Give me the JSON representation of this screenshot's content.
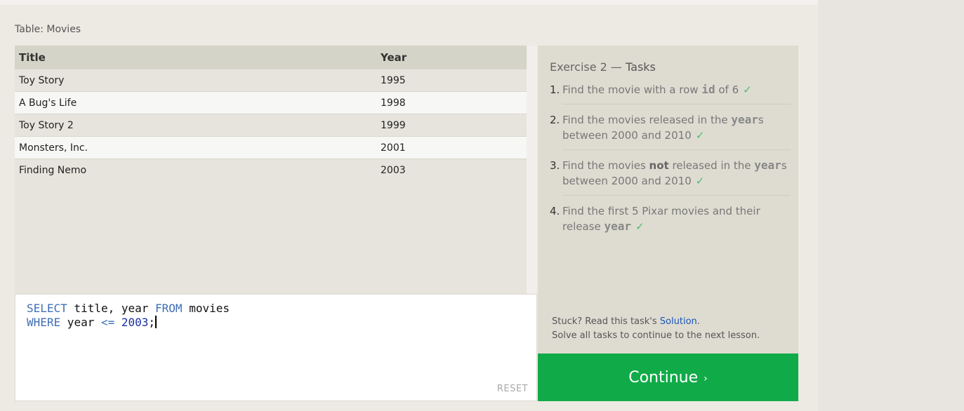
{
  "table": {
    "caption": "Table: Movies",
    "columns": [
      "Title",
      "Year"
    ],
    "rows": [
      [
        "Toy Story",
        "1995"
      ],
      [
        "A Bug's Life",
        "1998"
      ],
      [
        "Toy Story 2",
        "1999"
      ],
      [
        "Monsters, Inc.",
        "2001"
      ],
      [
        "Finding Nemo",
        "2003"
      ]
    ]
  },
  "editor": {
    "line1": {
      "kw1": "SELECT",
      "t1": " title, year ",
      "kw2": "FROM",
      "t2": " movies"
    },
    "line2": {
      "kw1": "WHERE",
      "t1": " year ",
      "op": "<=",
      "t2": " ",
      "num": "2003",
      "t3": ";"
    },
    "reset_label": "RESET"
  },
  "exercise": {
    "title": "Exercise 2",
    "dash": " — ",
    "subtitle": "Tasks",
    "tasks": [
      {
        "num": "1.",
        "parts": [
          "Find the movie with a row ",
          "id",
          " of 6"
        ]
      },
      {
        "num": "2.",
        "parts": [
          "Find the movies released in the ",
          "year",
          "s between 2000 and 2010"
        ]
      },
      {
        "num": "3.",
        "parts": [
          "Find the movies ",
          "not",
          " released in the ",
          "year",
          "s between 2000 and 2010"
        ]
      },
      {
        "num": "4.",
        "parts": [
          "Find the first 5 Pixar movies and their release ",
          "year"
        ]
      }
    ],
    "check": "✓",
    "stuck_prefix": "Stuck? Read this task's ",
    "solution_link": "Solution",
    "stuck_suffix": ".",
    "solve_all": "Solve all tasks to continue to the next lesson."
  },
  "continue": {
    "label": "Continue",
    "chevron": "›"
  },
  "colors": {
    "accent_green": "#10ab48",
    "check_green": "#4cbb6c",
    "keyword": "#3f6fb5",
    "number": "#1a2fa5"
  }
}
